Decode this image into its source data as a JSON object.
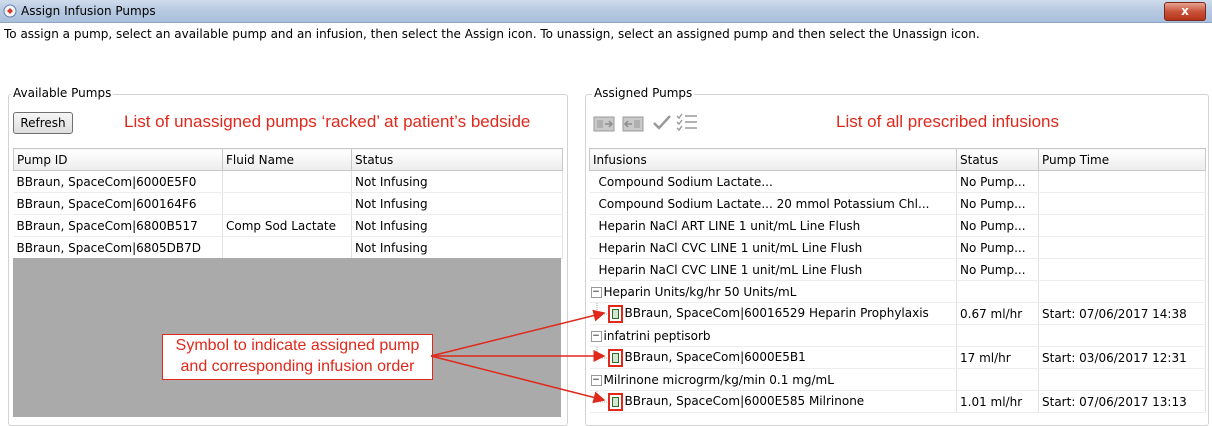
{
  "window": {
    "title": "Assign Infusion Pumps",
    "close_label": "x"
  },
  "instructions": "To assign a pump, select an available pump and an infusion, then select the Assign icon. To unassign, select an assigned pump and then select the Unassign icon.",
  "available": {
    "group_label": "Available Pumps",
    "refresh_label": "Refresh",
    "annotation": "List of unassigned pumps ‘racked’ at patient’s bedside",
    "columns": [
      "Pump ID",
      "Fluid Name",
      "Status"
    ],
    "rows": [
      {
        "pump_id": "BBraun, SpaceCom|6000E5F0",
        "fluid": "",
        "status": "Not Infusing"
      },
      {
        "pump_id": "BBraun, SpaceCom|600164F6",
        "fluid": "",
        "status": "Not Infusing"
      },
      {
        "pump_id": "BBraun, SpaceCom|6800B517",
        "fluid": "Comp Sod Lactate",
        "status": "Not Infusing"
      },
      {
        "pump_id": "BBraun, SpaceCom|6805DB7D",
        "fluid": "",
        "status": "Not Infusing"
      }
    ]
  },
  "assigned": {
    "group_label": "Assigned Pumps",
    "annotation": "List of all prescribed infusions",
    "toolbar_icons": [
      "assign-icon",
      "unassign-icon",
      "checkmark-icon",
      "checklist-icon"
    ],
    "columns": [
      "Infusions",
      "Status",
      "Pump Time"
    ],
    "rows": [
      {
        "infusion": "Compound Sodium Lactate...",
        "status": "No Pump...",
        "time": ""
      },
      {
        "infusion": "Compound Sodium Lactate... 20 mmol Potassium Chl...",
        "status": "No Pump...",
        "time": ""
      },
      {
        "infusion": "Heparin NaCl ART LINE 1 unit/mL Line Flush",
        "status": "No Pump...",
        "time": ""
      },
      {
        "infusion": "Heparin NaCl CVC LINE 1 unit/mL Line Flush",
        "status": "No Pump...",
        "time": ""
      },
      {
        "infusion": "Heparin NaCl CVC LINE 1 unit/mL Line Flush",
        "status": "No Pump...",
        "time": ""
      }
    ],
    "groups": [
      {
        "label": "Heparin Units/kg/hr 50 Units/mL",
        "toggle": "−",
        "child": {
          "infusion": "BBraun, SpaceCom|60016529 Heparin Prophylaxis",
          "status": "0.67 ml/hr",
          "time": "Start: 07/06/2017 14:38"
        }
      },
      {
        "label": "infatrini peptisorb",
        "toggle": "−",
        "child": {
          "infusion": "BBraun, SpaceCom|6000E5B1",
          "status": "17 ml/hr",
          "time": "Start: 03/06/2017 12:31"
        }
      },
      {
        "label": "Milrinone microgrm/kg/min 0.1 mg/mL",
        "toggle": "−",
        "child": {
          "infusion": "BBraun, SpaceCom|6000E585 Milrinone",
          "status": "1.01 ml/hr",
          "time": "Start: 07/06/2017 13:13"
        }
      }
    ]
  },
  "callout": {
    "line1": "Symbol to indicate assigned pump",
    "line2": "and corresponding infusion order"
  },
  "colors": {
    "annotation": "#e0281b",
    "gray_area": "#aaaaaa",
    "titlebar": "#b9cbe2"
  }
}
